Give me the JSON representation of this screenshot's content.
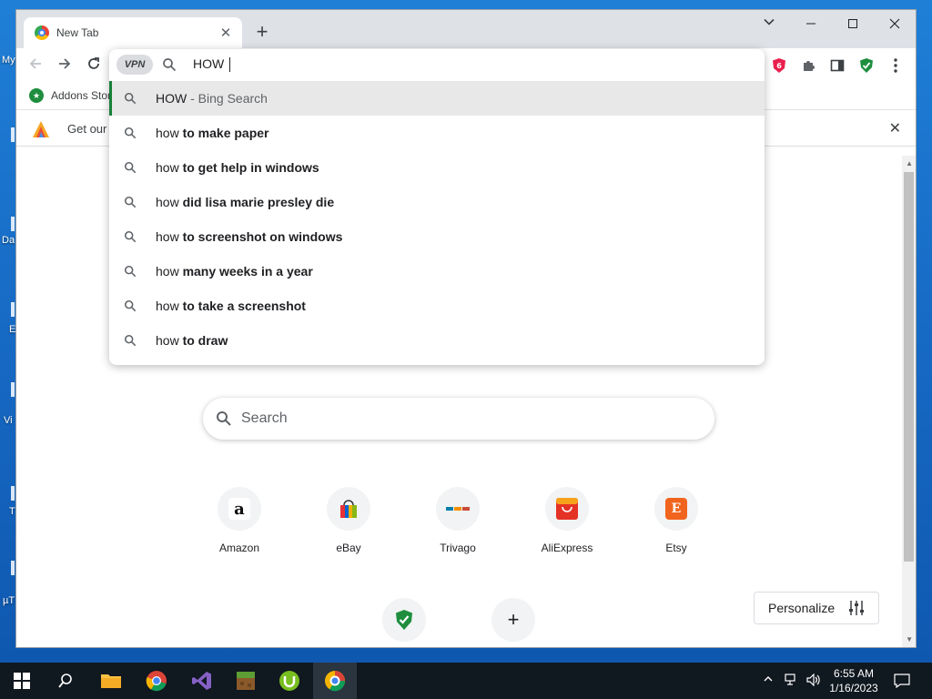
{
  "desktop": {
    "labels": [
      "My",
      "Da",
      "E",
      "Vi",
      "T",
      "µT"
    ]
  },
  "tab": {
    "title": "New Tab",
    "close": "✕"
  },
  "newtab": "+",
  "window_controls": {
    "tabsearch": "⌄",
    "minimize": "—",
    "maximize": "☐",
    "close": "✕"
  },
  "nav": {
    "back": "←",
    "forward": "→",
    "reload": "↻"
  },
  "omnibox": {
    "vpn": "VPN",
    "input_text": "HOW ",
    "suggestions": [
      {
        "pre": "HOW",
        "bold": "",
        "suffix": " - Bing Search"
      },
      {
        "pre": "how",
        "bold": " to make paper",
        "suffix": ""
      },
      {
        "pre": "how",
        "bold": " to get help in windows",
        "suffix": ""
      },
      {
        "pre": "how",
        "bold": " did lisa marie presley die",
        "suffix": ""
      },
      {
        "pre": "how",
        "bold": " to screenshot on windows",
        "suffix": ""
      },
      {
        "pre": "how",
        "bold": " many weeks in a year",
        "suffix": ""
      },
      {
        "pre": "how",
        "bold": " to take a screenshot",
        "suffix": ""
      },
      {
        "pre": "how",
        "bold": " to draw",
        "suffix": ""
      }
    ]
  },
  "bookmarks": {
    "item": "Addons Stor"
  },
  "infobar": {
    "text": "Get our",
    "close": "✕"
  },
  "ntp": {
    "search_placeholder": "Search",
    "tiles": [
      {
        "label": "Amazon",
        "icon": "amazon-logo"
      },
      {
        "label": "eBay",
        "icon": "shopping-bag-logo"
      },
      {
        "label": "Trivago",
        "icon": "trivago-logo"
      },
      {
        "label": "AliExpress",
        "icon": "aliexpress-logo"
      },
      {
        "label": "Etsy",
        "icon": "etsy-logo"
      }
    ],
    "personalize": "Personalize",
    "add_shortcut": "+"
  },
  "taskbar": {
    "time": "6:55 AM",
    "date": "1/16/2023"
  },
  "colors": {
    "accent_green": "#188038",
    "chrome_frame": "#dee1e6",
    "taskbar": "#101820"
  }
}
